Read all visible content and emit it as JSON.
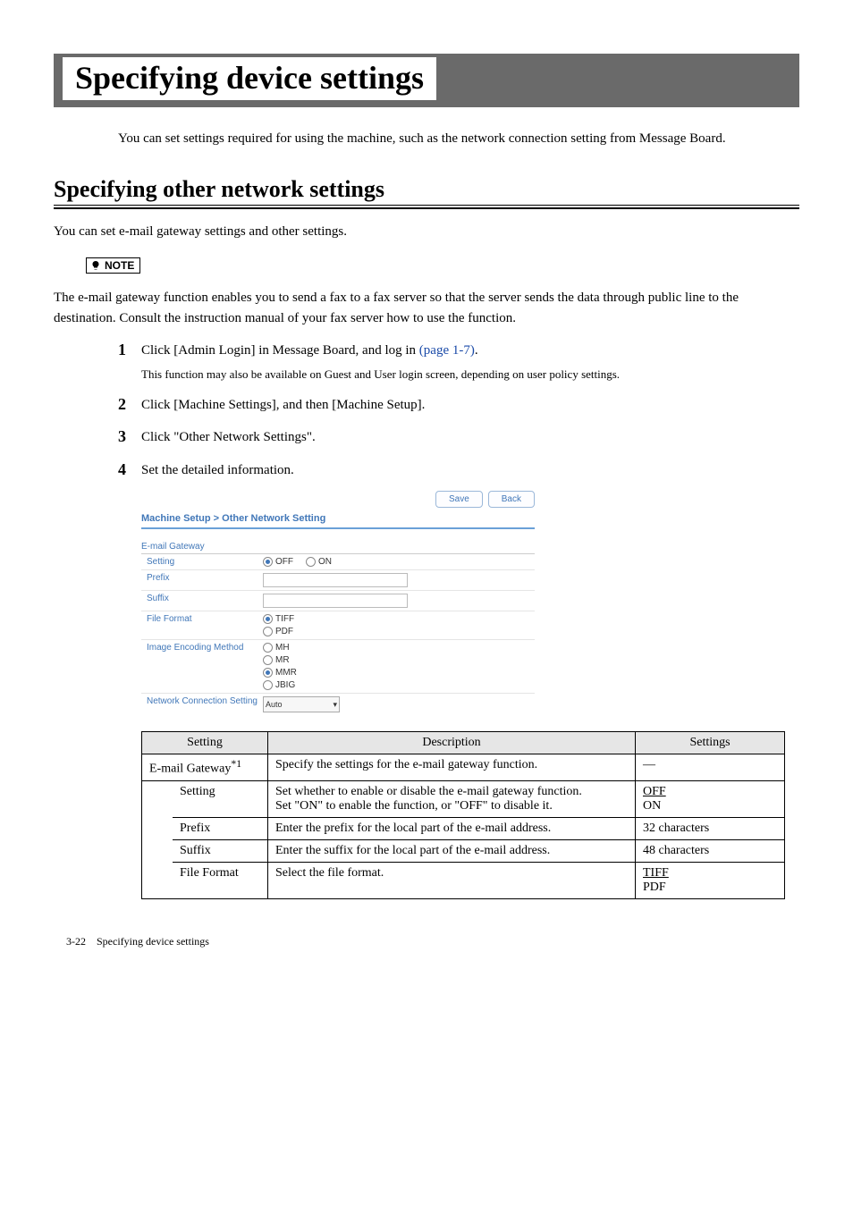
{
  "page_title": "Specifying device settings",
  "intro": "You can set settings required for using the machine, such as the network connection setting from Message Board.",
  "section_heading": "Specifying other network settings",
  "section_intro": "You can set e-mail gateway settings and other settings.",
  "note": {
    "label": "NOTE",
    "text": "The e-mail gateway function enables you to send a fax to a fax server so that the server sends the data through public line to the destination.  Consult the instruction manual of your fax server how to use the function."
  },
  "steps": [
    {
      "num": "1",
      "text_pre": "Click [Admin Login] in Message Board, and log in ",
      "link": "(page 1-7)",
      "text_post": ".",
      "sub": "This function may also be available on Guest and User login screen, depending on user policy settings."
    },
    {
      "num": "2",
      "text_pre": "Click [Machine Settings], and then [Machine Setup].",
      "link": "",
      "text_post": "",
      "sub": ""
    },
    {
      "num": "3",
      "text_pre": "Click \"Other Network Settings\".",
      "link": "",
      "text_post": "",
      "sub": ""
    },
    {
      "num": "4",
      "text_pre": "Set the detailed information.",
      "link": "",
      "text_post": "",
      "sub": ""
    }
  ],
  "ui": {
    "save": "Save",
    "back": "Back",
    "breadcrumb": "Machine Setup > Other Network Setting",
    "section1": "E-mail Gateway",
    "rows": {
      "setting_label": "Setting",
      "off": "OFF",
      "on": "ON",
      "prefix_label": "Prefix",
      "suffix_label": "Suffix",
      "file_format_label": "File Format",
      "tiff": "TIFF",
      "pdf": "PDF",
      "encoding_label": "Image Encoding Method",
      "mh": "MH",
      "mr": "MR",
      "mmr": "MMR",
      "jbig": "JBIG",
      "net_conn_label": "Network Connection Setting",
      "auto": "Auto"
    }
  },
  "table": {
    "headers": {
      "setting": "Setting",
      "description": "Description",
      "settings": "Settings"
    },
    "rows": [
      {
        "name": "E-mail Gateway",
        "sup": "*1",
        "desc": "Specify the settings for the e-mail gateway function.",
        "settings": "—",
        "sub": false
      },
      {
        "name": "Setting",
        "desc": "Set whether to enable or disable the e-mail gateway function.\nSet \"ON\" to enable the function, or \"OFF\" to disable it.",
        "settings_u1": "OFF",
        "settings_2": "ON",
        "sub": true
      },
      {
        "name": "Prefix",
        "desc": "Enter the prefix for the local part of the e-mail address.",
        "settings": "32 characters",
        "sub": true
      },
      {
        "name": "Suffix",
        "desc": "Enter the suffix for the local part of the e-mail address.",
        "settings": "48 characters",
        "sub": true
      },
      {
        "name": "File Format",
        "desc": "Select the file format.",
        "settings_u1": "TIFF",
        "settings_2": "PDF",
        "sub": true
      }
    ]
  },
  "footer": {
    "pagenum": "3-22",
    "text": "Specifying device settings"
  }
}
